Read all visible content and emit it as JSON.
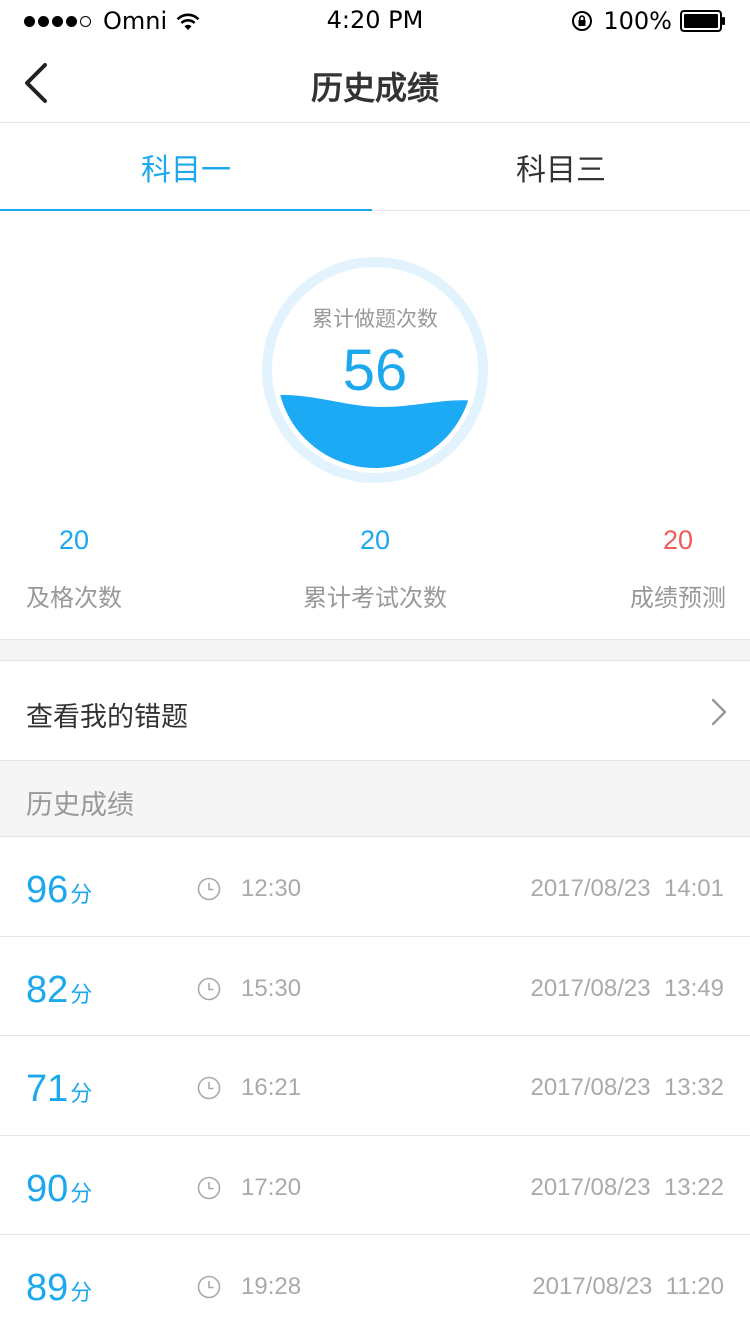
{
  "status_bar": {
    "carrier": "Omni",
    "time": "4:20 PM",
    "battery": "100%"
  },
  "nav": {
    "title": "历史成绩",
    "back_icon": "chevron-left-icon"
  },
  "tabs": [
    {
      "label": "科目一",
      "active": true
    },
    {
      "label": "科目三",
      "active": false
    }
  ],
  "summary": {
    "gauge_label": "累计做题次数",
    "gauge_value": "56",
    "stats": [
      {
        "value": "20",
        "label": "及格次数",
        "color": "#1da8ee"
      },
      {
        "value": "20",
        "label": "累计考试次数",
        "color": "#1da8ee"
      },
      {
        "value": "20",
        "label": "成绩预测",
        "color": "#f05a5a"
      }
    ]
  },
  "wrong_questions": {
    "label": "查看我的错题"
  },
  "history": {
    "title": "历史成绩",
    "unit": "分",
    "rows": [
      {
        "score": "96",
        "duration": "12:30",
        "datetime": "2017/08/23  14:01"
      },
      {
        "score": "82",
        "duration": "15:30",
        "datetime": "2017/08/23  13:49"
      },
      {
        "score": "71",
        "duration": "16:21",
        "datetime": "2017/08/23  13:32"
      },
      {
        "score": "90",
        "duration": "17:20",
        "datetime": "2017/08/23  13:22"
      },
      {
        "score": "89",
        "duration": "19:28",
        "datetime": "2017/08/23  11:20"
      }
    ]
  },
  "colors": {
    "accent": "#1da8ee",
    "warning": "#f05a5a",
    "muted_text": "#999999"
  }
}
